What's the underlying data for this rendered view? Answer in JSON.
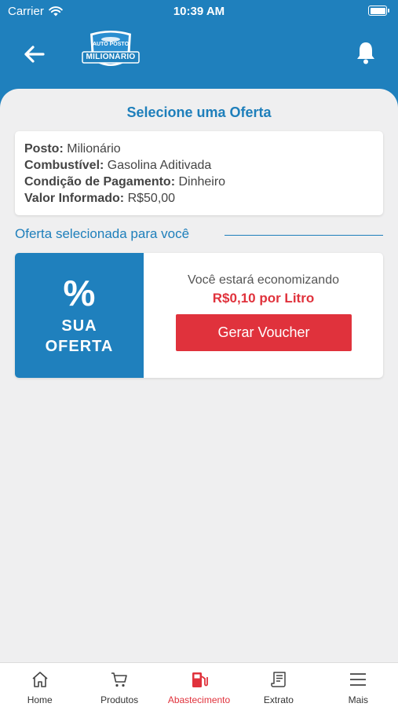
{
  "status_bar": {
    "carrier": "Carrier",
    "time": "10:39 AM",
    "battery_level": 1.0
  },
  "header": {
    "logo": {
      "line1": "AUTO POSTO",
      "line2": "MILIONÁRIO"
    },
    "back_icon": "arrow-left-icon",
    "bell_icon": "bell-icon"
  },
  "page": {
    "title": "Selecione uma Oferta"
  },
  "info": {
    "posto_label": "Posto:",
    "posto_value": "Milionário",
    "combustivel_label": "Combustível:",
    "combustivel_value": "Gasolina Aditivada",
    "pagamento_label": "Condição de Pagamento:",
    "pagamento_value": "Dinheiro",
    "valor_label": "Valor Informado:",
    "valor_value": "R$50,00"
  },
  "section": {
    "label": "Oferta selecionada para você"
  },
  "offer": {
    "percent": "%",
    "badge_line1": "SUA",
    "badge_line2": "OFERTA",
    "savings_text": "Você estará economizando",
    "savings_value": "R$0,10 por Litro",
    "button_label": "Gerar Voucher"
  },
  "colors": {
    "primary": "#1f80bd",
    "accent": "#e0323c",
    "background": "#efeff0"
  },
  "tabbar": {
    "items": [
      {
        "label": "Home",
        "icon": "home-icon",
        "active": false
      },
      {
        "label": "Produtos",
        "icon": "cart-icon",
        "active": false
      },
      {
        "label": "Abastecimento",
        "icon": "fuel-pump-icon",
        "active": true
      },
      {
        "label": "Extrato",
        "icon": "receipt-icon",
        "active": false
      },
      {
        "label": "Mais",
        "icon": "menu-icon",
        "active": false
      }
    ]
  }
}
